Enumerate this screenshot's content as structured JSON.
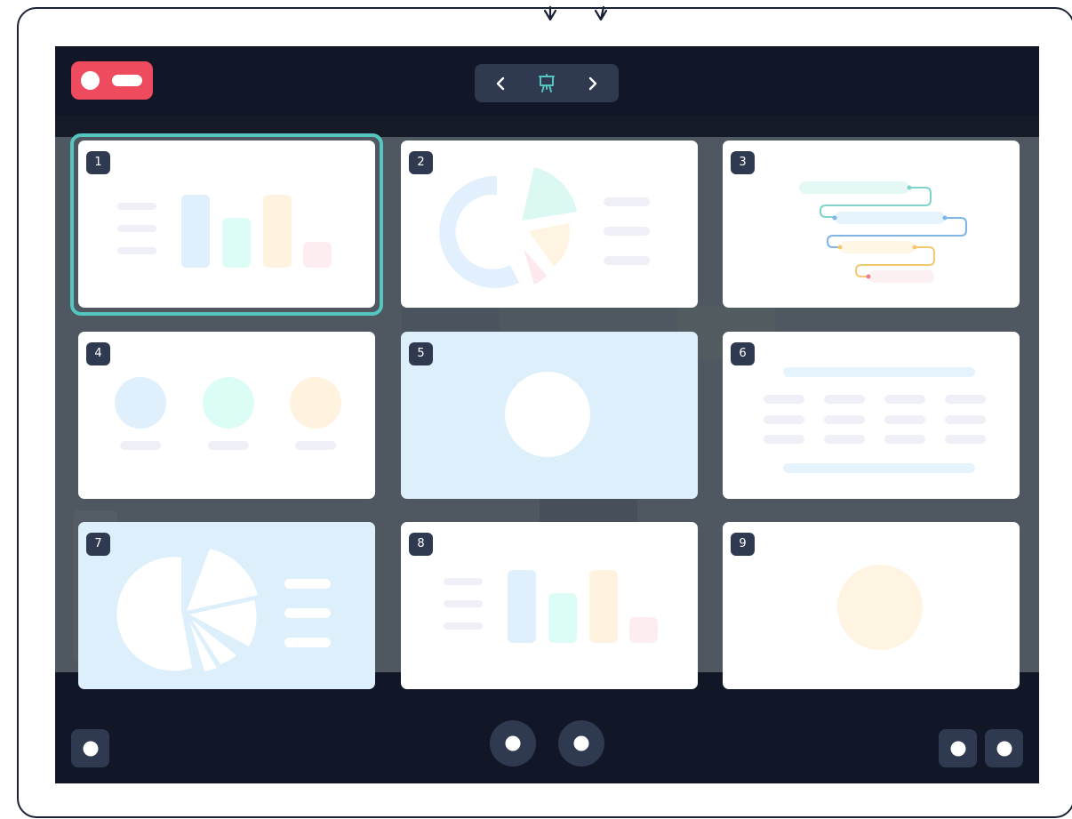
{
  "toolbar": {
    "exit_icon": "exit-toggle-icon",
    "prev_icon": "chevron-left-icon",
    "present_icon": "presentation-easel-icon",
    "next_icon": "chevron-right-icon"
  },
  "colors": {
    "accent": "#55c5bf",
    "danger": "#ee4b5f",
    "chrome": "#111726",
    "button": "#2f3a51",
    "slide_tint": "#ddeffb"
  },
  "slides": [
    {
      "number": "1",
      "layout": "bar-chart",
      "selected": true
    },
    {
      "number": "2",
      "layout": "donut-pie"
    },
    {
      "number": "3",
      "layout": "timeline"
    },
    {
      "number": "4",
      "layout": "three-circles"
    },
    {
      "number": "5",
      "layout": "single-circle"
    },
    {
      "number": "6",
      "layout": "table"
    },
    {
      "number": "7",
      "layout": "pie-list"
    },
    {
      "number": "8",
      "layout": "bar-chart"
    },
    {
      "number": "9",
      "layout": "single-circle"
    }
  ],
  "bottom_controls": [
    {
      "icon": "menu-dot-icon"
    },
    {
      "icon": "play-dot-icon"
    },
    {
      "icon": "pause-dot-icon"
    },
    {
      "icon": "settings-dot-icon"
    },
    {
      "icon": "fullscreen-dot-icon"
    }
  ]
}
